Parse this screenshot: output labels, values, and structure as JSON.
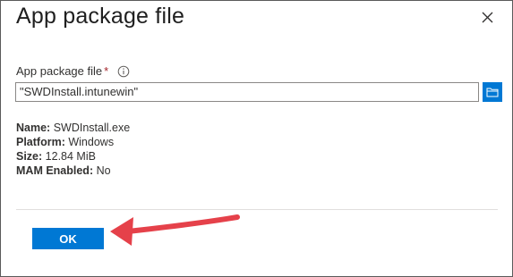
{
  "dialog": {
    "title": "App package file",
    "close_icon": "close-icon"
  },
  "field": {
    "label": "App package file",
    "required_marker": "*",
    "info_icon": "info-icon",
    "value": "\"SWDInstall.intunewin\"",
    "browse_icon": "folder-icon"
  },
  "package_info": {
    "name_label": "Name:",
    "name_value": "SWDInstall.exe",
    "platform_label": "Platform:",
    "platform_value": "Windows",
    "size_label": "Size:",
    "size_value": "12.84 MiB",
    "mam_label": "MAM Enabled:",
    "mam_value": "No"
  },
  "actions": {
    "ok_label": "OK"
  },
  "colors": {
    "accent": "#0078d4",
    "required": "#a4262c",
    "annotation_arrow": "#e5414a"
  }
}
